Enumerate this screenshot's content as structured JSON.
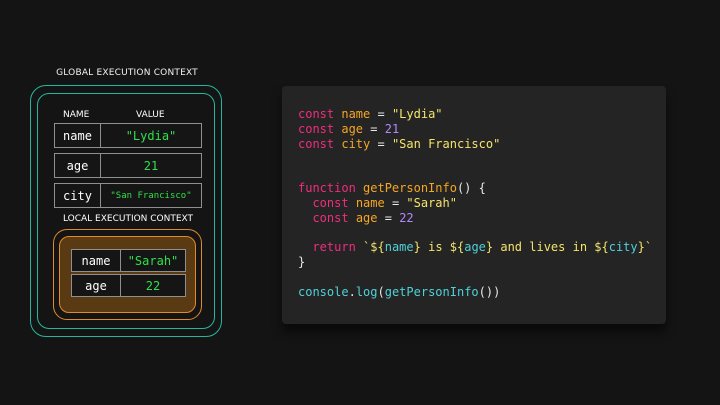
{
  "global": {
    "title": "GLOBAL EXECUTION CONTEXT",
    "header_name": "NAME",
    "header_value": "VALUE",
    "vars": [
      {
        "name": "name",
        "value": "\"Lydia\""
      },
      {
        "name": "age",
        "value": "21"
      },
      {
        "name": "city",
        "value": "\"San Francisco\""
      }
    ]
  },
  "local": {
    "title": "LOCAL EXECUTION CONTEXT",
    "vars": [
      {
        "name": "name",
        "value": "\"Sarah\""
      },
      {
        "name": "age",
        "value": "22"
      }
    ]
  },
  "code": {
    "kw_const": "const",
    "kw_function": "function",
    "kw_return": "return",
    "id_name": "name",
    "id_age": "age",
    "id_city": "city",
    "str_lydia": "\"Lydia\"",
    "num_21": "21",
    "str_sf": "\"San Francisco\"",
    "fn_name": "getPersonInfo",
    "str_sarah": "\"Sarah\"",
    "num_22": "22",
    "console": "console",
    "log": "log",
    "fn_call": "getPersonInfo"
  },
  "colors": {
    "global_border": "#22b8a0",
    "local_border": "#e08a2a",
    "value_green": "#2fe04a",
    "code_bg": "#242424"
  }
}
